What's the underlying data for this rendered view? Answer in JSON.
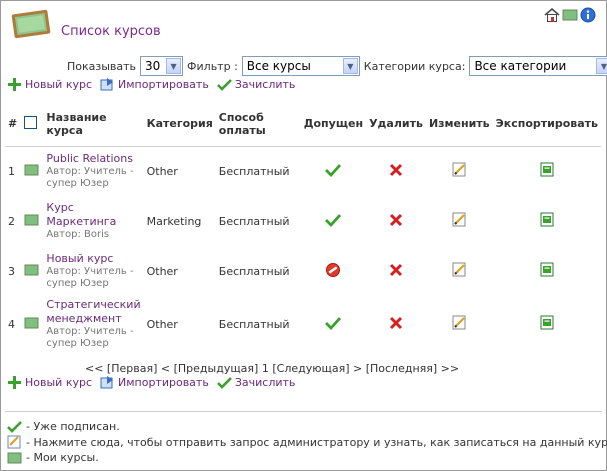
{
  "header": {
    "title": "Список курсов"
  },
  "filters": {
    "show_label": "Показывать",
    "show_value": "30",
    "filter_label": "Фильтр :",
    "filter_value": "Все курсы",
    "category_label": "Категории курса:",
    "category_value": "Все категории"
  },
  "actions": {
    "new_course": "Новый курс",
    "import": "Импортировать",
    "enroll": "Зачислить"
  },
  "table": {
    "headers": {
      "num": "#",
      "name_line1": "Название",
      "name_line2": "курса",
      "category": "Категория",
      "payment": "Способ оплаты",
      "admitted": "Допущен",
      "delete": "Удалить",
      "edit": "Изменить",
      "export": "Экспортировать"
    },
    "rows": [
      {
        "num": "1",
        "name_line1": "Public Relations",
        "name_line2": "",
        "author_line1": "Автор: Учитель -",
        "author_line2": "супер Юзер",
        "category": "Other",
        "payment": "Бесплатный",
        "admitted": "yes"
      },
      {
        "num": "2",
        "name_line1": "Курс",
        "name_line2": "Маркетинга",
        "author_line1": "Автор: Boris",
        "author_line2": "",
        "category": "Marketing",
        "payment": "Бесплатный",
        "admitted": "yes"
      },
      {
        "num": "3",
        "name_line1": "Новый курс",
        "name_line2": "",
        "author_line1": "Автор: Учитель -",
        "author_line2": "супер Юзер",
        "category": "Other",
        "payment": "Бесплатный",
        "admitted": "no"
      },
      {
        "num": "4",
        "name_line1": "Стратегический",
        "name_line2": "менеджмент",
        "author_line1": "Автор: Учитель -",
        "author_line2": "супер Юзер",
        "category": "Other",
        "payment": "Бесплатный",
        "admitted": "yes"
      }
    ]
  },
  "pager": {
    "first": "<< [Первая]",
    "prev": "< [Предыдущая]",
    "current": "1",
    "next": "[Следующая] >",
    "last": "[Последняя] >>"
  },
  "legend": {
    "enrolled": "- Уже подписан.",
    "request": "- Нажмите сюда, чтобы отправить запрос администратору и узнать, как записаться на данный курс.",
    "my_courses": "- Мои курсы."
  },
  "colors": {
    "link": "#6b2a7a",
    "check": "#3aa12b",
    "cross": "#d42020",
    "board": "#7fbf7f"
  }
}
